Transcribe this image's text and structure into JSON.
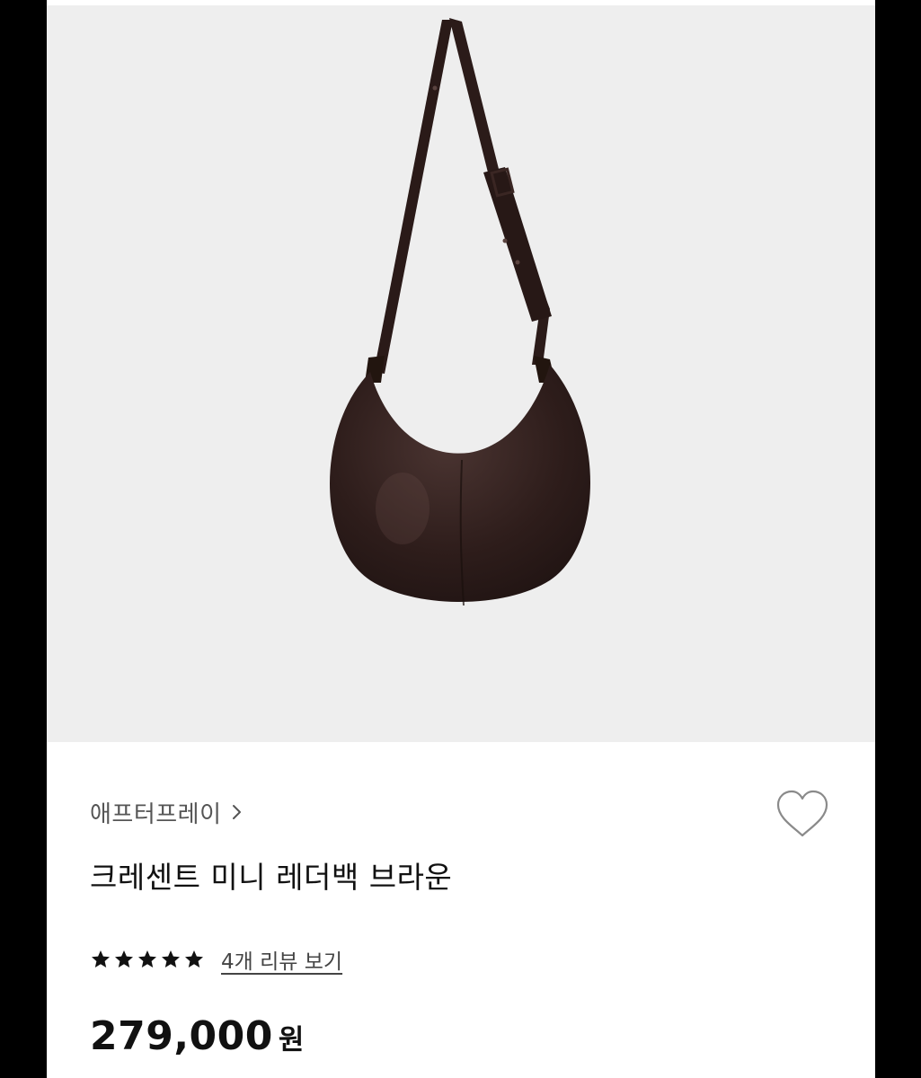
{
  "product": {
    "image_alt": "dark brown crescent leather shoulder bag with long adjustable strap",
    "brand": "애프터프레이",
    "title": "크레센트 미니 레더백 브라운",
    "rating": 5,
    "rating_max": 5,
    "review_link": "4개 리뷰 보기",
    "price": "279,000",
    "price_unit": "원"
  },
  "colors": {
    "image_bg": "#eeeeee",
    "bag_leather": "#2e1d1b",
    "text_primary": "#111111",
    "text_secondary": "#555555"
  },
  "icons": {
    "brand_chevron": "chevron-right-icon",
    "wish": "heart-outline-icon",
    "star": "star-filled-icon"
  }
}
